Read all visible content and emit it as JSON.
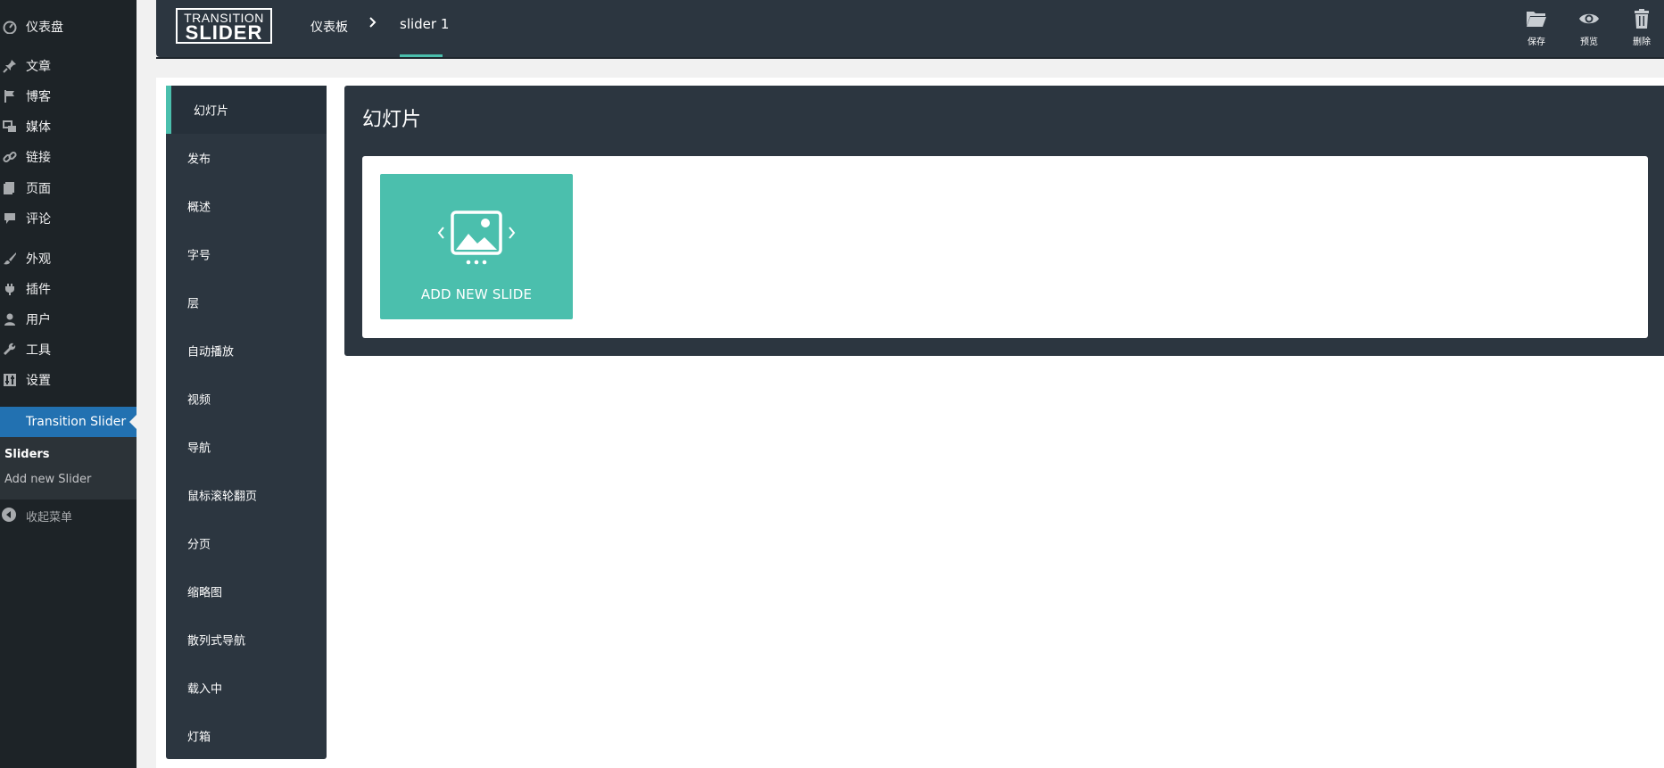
{
  "wp_sidebar": {
    "items": [
      {
        "label": "仪表盘",
        "icon": "dashboard-icon"
      },
      {
        "label": "文章",
        "icon": "pin-icon"
      },
      {
        "label": "博客",
        "icon": "flag-icon"
      },
      {
        "label": "媒体",
        "icon": "media-icon"
      },
      {
        "label": "链接",
        "icon": "link-icon"
      },
      {
        "label": "页面",
        "icon": "page-icon"
      },
      {
        "label": "评论",
        "icon": "comment-icon"
      },
      {
        "label": "外观",
        "icon": "brush-icon"
      },
      {
        "label": "插件",
        "icon": "plug-icon"
      },
      {
        "label": "用户",
        "icon": "user-icon"
      },
      {
        "label": "工具",
        "icon": "wrench-icon"
      },
      {
        "label": "设置",
        "icon": "settings-icon"
      },
      {
        "label": "Transition Slider",
        "icon": "slider-icon"
      }
    ],
    "submenu": [
      {
        "label": "Sliders"
      },
      {
        "label": "Add new Slider"
      }
    ],
    "collapse_label": "收起菜单"
  },
  "header": {
    "logo_top": "TRANSITION",
    "logo_bottom": "SLIDER",
    "breadcrumb": {
      "home": "仪表板",
      "separator": "›",
      "current": "slider 1"
    },
    "actions": {
      "save": "保存",
      "preview": "预览",
      "delete": "删除"
    }
  },
  "settings_nav": {
    "items": [
      "幻灯片",
      "发布",
      "概述",
      "字号",
      "层",
      "自动播放",
      "视频",
      "导航",
      "鼠标滚轮翻页",
      "分页",
      "缩略图",
      "散列式导航",
      "载入中",
      "灯箱"
    ]
  },
  "slides_panel": {
    "title": "幻灯片",
    "add_new_label": "ADD NEW SLIDE"
  },
  "colors": {
    "wp_sidebar_bg": "#1d2327",
    "wp_active": "#2271b1",
    "panel_dark": "#2c3640",
    "accent_teal": "#4bbfad"
  }
}
